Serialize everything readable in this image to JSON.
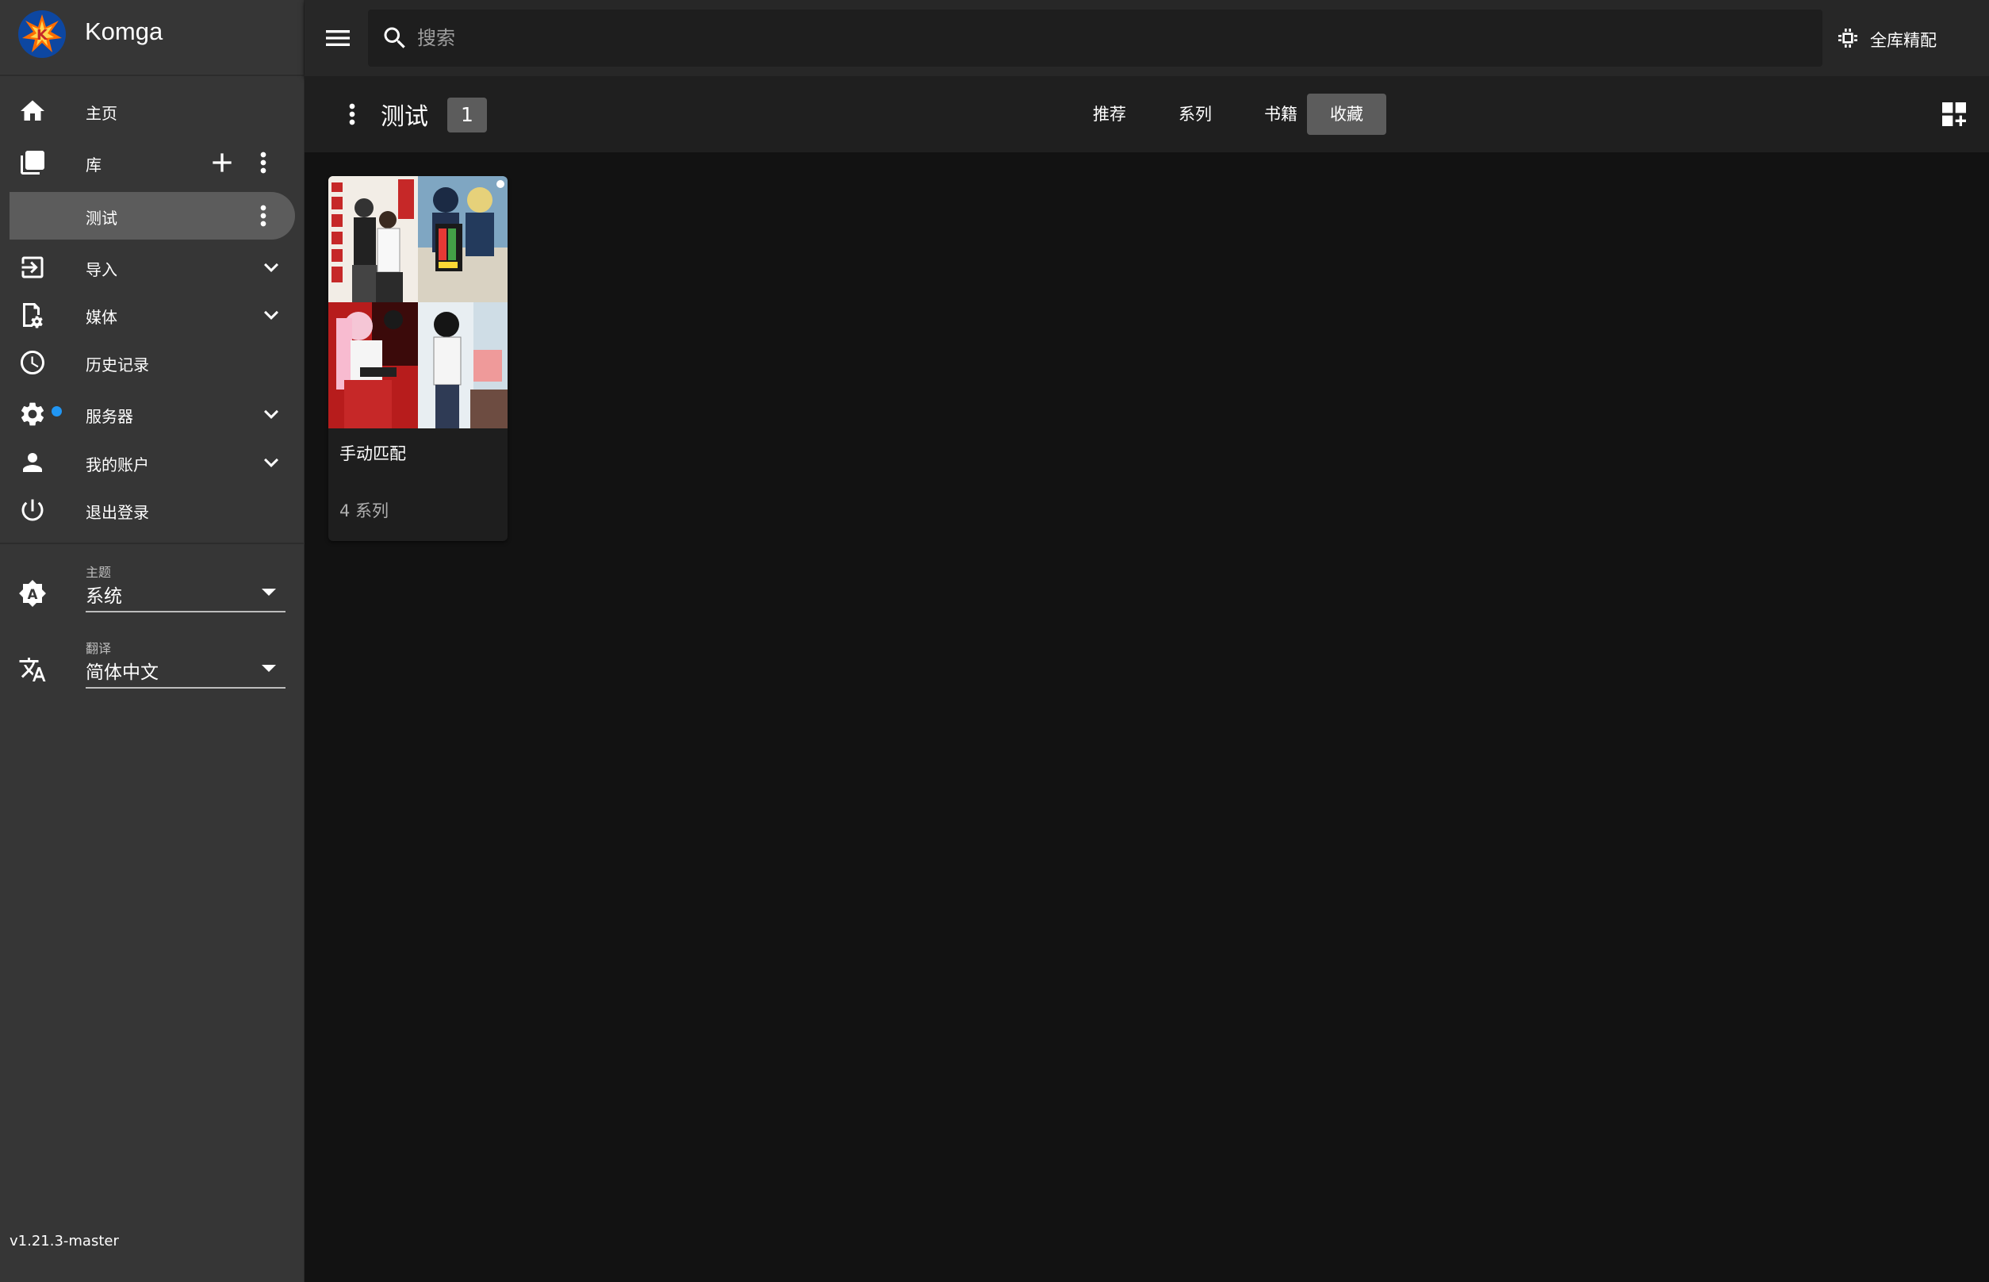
{
  "app": {
    "name": "Komga",
    "version": "v1.21.3-master"
  },
  "nav": {
    "home": "主页",
    "libraries": "库",
    "current_library": "测试",
    "import": "导入",
    "media": "媒体",
    "history": "历史记录",
    "server": "服务器",
    "account": "我的账户",
    "logout": "退出登录"
  },
  "settings": {
    "theme": {
      "caption": "主题",
      "value": "系统"
    },
    "language": {
      "caption": "翻译",
      "value": "简体中文"
    }
  },
  "search": {
    "placeholder": "搜索"
  },
  "topbar": {
    "match_all": "全库精配"
  },
  "toolbar": {
    "title": "测试",
    "count": "1",
    "tabs": [
      "推荐",
      "系列",
      "书籍",
      "收藏"
    ],
    "active_tab": "收藏"
  },
  "collections": [
    {
      "title": "手动匹配",
      "subtitle": "4 系列"
    }
  ],
  "colors": {
    "sidebar_bg": "#363636",
    "topbar_bg": "#272727",
    "content_bg": "#121212",
    "active_bg": "#5c5c5c",
    "accent_dot": "#2196f3"
  }
}
